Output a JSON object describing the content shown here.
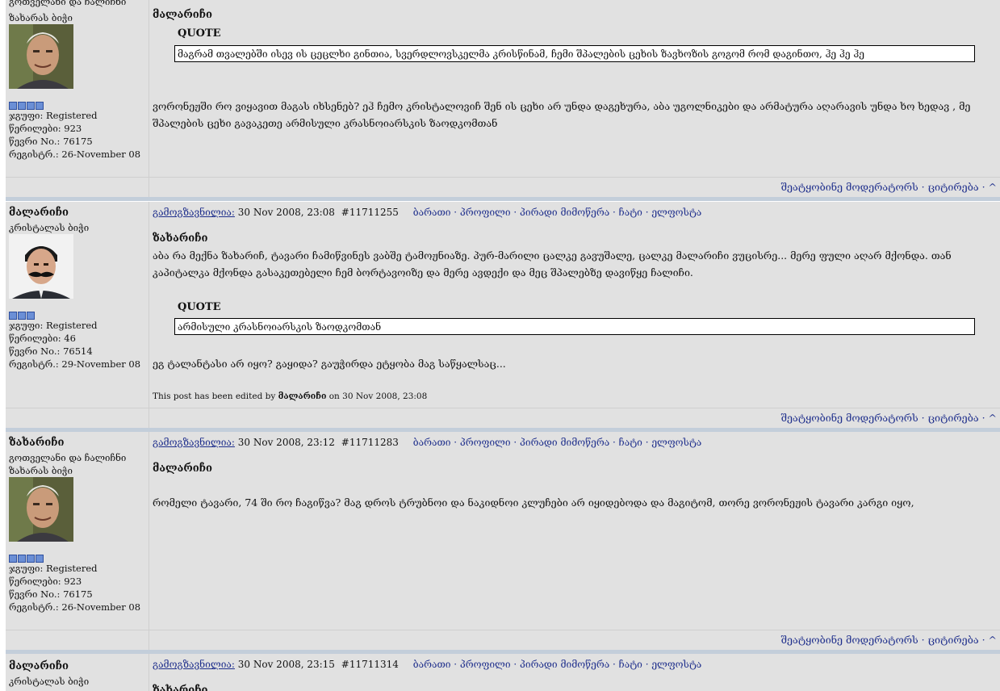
{
  "posts": [
    {
      "author": "",
      "rank": "გოთველანი და ჩალიჩნი",
      "title": "ზახარას ბიჭი",
      "pips": 4,
      "group": "ჯგუფი: Registered",
      "posts_count": "წერილები: 923",
      "member_no": "წევრი No.: 76175",
      "registered": "რეგისტრ.: 26-November 08",
      "quoted_author": "მალარიჩი",
      "quote_label": "QUOTE",
      "quote_text": "მაგრამ თვალებში ისევ ის ცეცლხი გინთია, სვერდლოვსკელმა კრისწინამ, ჩემი შპალების ცეხის ზავხოზის გოგომ რომ დაგინთო, ჰე ჰე ჰე",
      "body": "ვორონეჟში რო ვიყავით მაგას იხსენებ? ეჰ ჩემო კრისტალოვიჩ შენ ის ცეხი არ უნდა დაგეხურა, აბა უგოლნიკები და არმატურა აღარავის უნდა ხო ხედავ , მე შპალების ცეხი გავაკეთე არმისული კრასნოიარსკის ზაოდკომთან"
    },
    {
      "author": "მალარიჩი",
      "rank": "კრისტალას ბიჭი",
      "pips": 3,
      "group": "ჯგუფი: Registered",
      "posts_count": "წერილები: 46",
      "member_no": "წევრი No.: 76514",
      "registered": "რეგისტრ.: 29-November 08",
      "posted_label": "გამოგზავნილია:",
      "date": "30 Nov 2008, 23:08",
      "post_id": "#11711255",
      "links": "ბარათი · პროფილი · პირადი მიმოწერა · ჩატი · ელფოსტა",
      "quoted_author": "ზახარიჩი",
      "body1": "აბა რა მექნა ზახარიჩ, ტავარი ჩამიწვინეს ვაბშე ტამოჟნიაზე. პურ-მარილი ცალკე გავუშალე, ცალკე მალარიჩი ვუცისრე... მერე ფული აღარ მქონდა. თან კაპიტალკა მქონდა გასაკეთებელი ჩემ ბორტავოიზე და მერე ავდექი და მეც შპალებზე დავიწყე ჩალიჩი.",
      "quote_label": "QUOTE",
      "quote_text": "არმისული კრასნოიარსკის ზაოდკომთან",
      "body2": "ეგ ტალანტასი არ იყო? გაყიდა? გაუჭირდა ეტყობა მაგ საწყალსაც...",
      "edited_prefix": "This post has been edited by",
      "edited_by": "მალარიჩი",
      "edited_suffix": "on 30 Nov 2008, 23:08"
    },
    {
      "author": "ზახარიჩი",
      "rank": "გოთველანი და ჩალიჩნი",
      "title": "ზახარას ბიჭი",
      "pips": 4,
      "group": "ჯგუფი: Registered",
      "posts_count": "წერილები: 923",
      "member_no": "წევრი No.: 76175",
      "registered": "რეგისტრ.: 26-November 08",
      "posted_label": "გამოგზავნილია:",
      "date": "30 Nov 2008, 23:12",
      "post_id": "#11711283",
      "links": "ბარათი · პროფილი · პირადი მიმოწერა · ჩატი · ელფოსტა",
      "quoted_author": "მალარიჩი",
      "body": "რომელი ტავარი, 74 ში რო ჩაგიწვა? მაგ დროს ტრუბნოი და ნაკიდნოი კლუჩები არ იყიდებოდა და მაგიტომ, თორე ვორონეჟის ტავარი კარგი იყო,"
    },
    {
      "author": "მალარიჩი",
      "rank": "კრისტალას ბიჭი",
      "posted_label": "გამოგზავნილია:",
      "date": "30 Nov 2008, 23:15",
      "post_id": "#11711314",
      "links": "ბარათი · პროფილი · პირადი მიმოწერა · ჩატი · ელფოსტა",
      "quoted_author": "ზახარიჩი"
    }
  ],
  "actions": "შეატყობინე მოდერატორს · ციტირება · ^"
}
